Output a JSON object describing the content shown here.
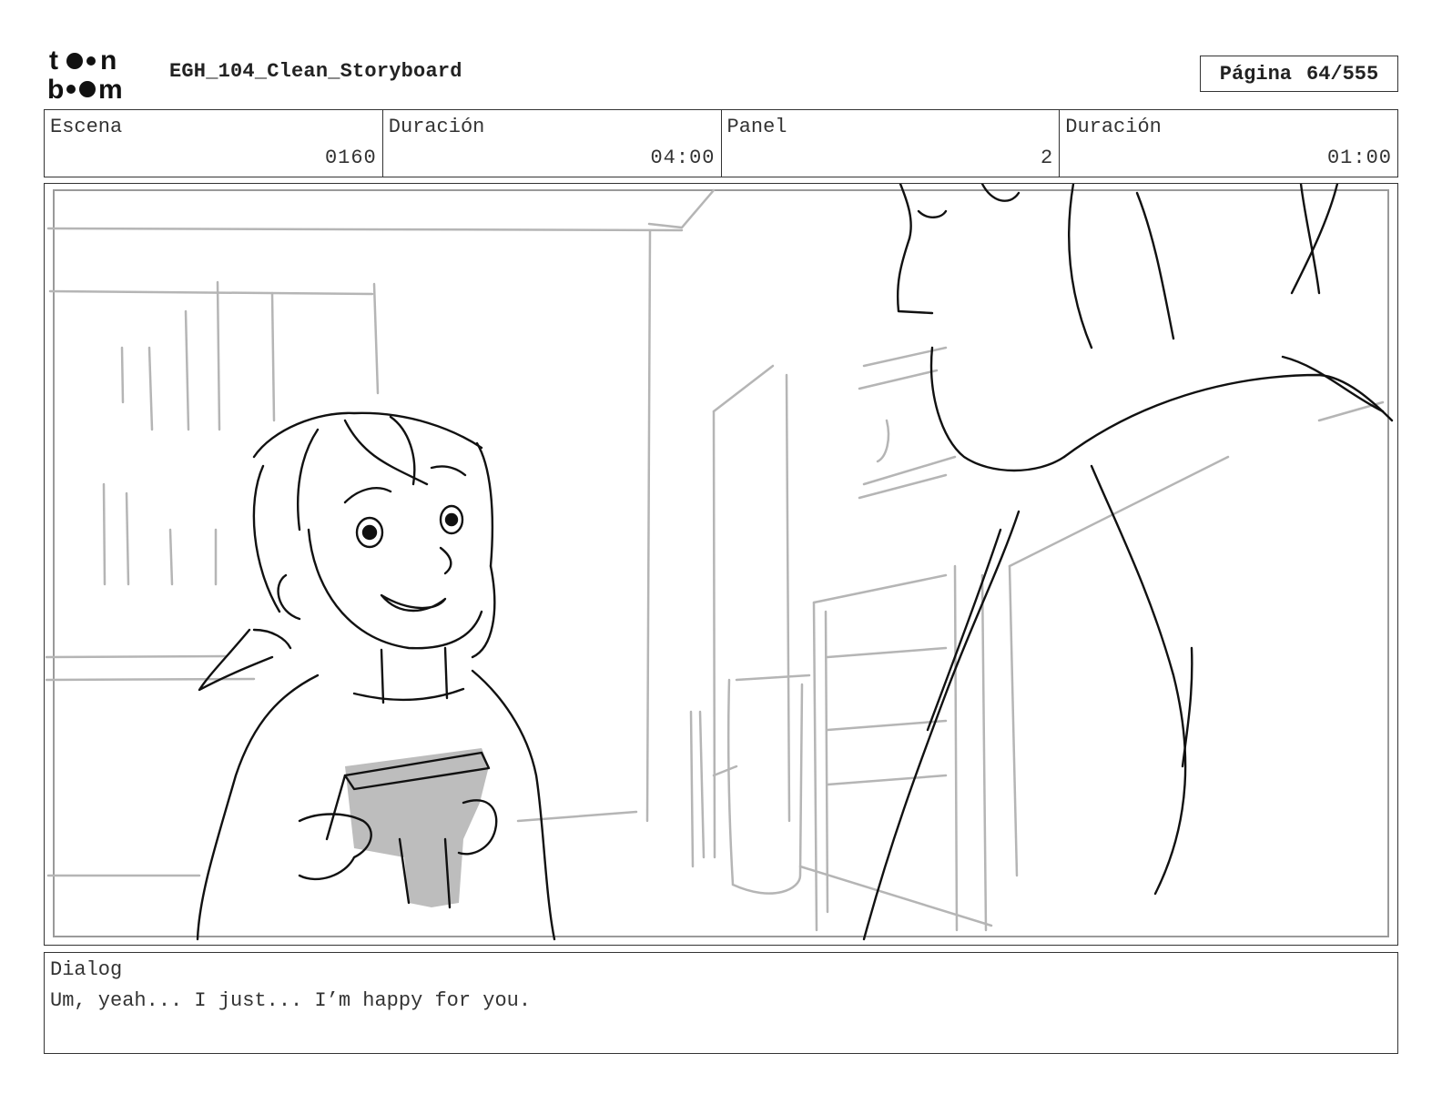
{
  "header": {
    "logo_text_top": "toon",
    "logo_text_bottom": "boom",
    "title": "EGH_104_Clean_Storyboard",
    "page_label": "Página",
    "page_value": "64/555"
  },
  "info": {
    "scene_label": "Escena",
    "scene_value": "0160",
    "scene_duration_label": "Duración",
    "scene_duration_value": "04:00",
    "panel_label": "Panel",
    "panel_value": "2",
    "panel_duration_label": "Duración",
    "panel_duration_value": "01:00"
  },
  "dialog": {
    "label": "Dialog",
    "text": "Um, yeah... I just... I’m happy for you."
  },
  "colors": {
    "sketch_line": "#111111",
    "background_line": "#b5b5b5",
    "tone_fill": "#bdbdbd"
  }
}
